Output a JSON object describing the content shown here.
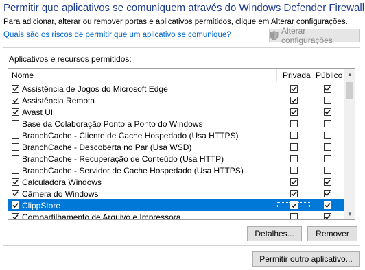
{
  "header": {
    "title": "Permitir que aplicativos se comuniquem através do Windows Defender Firewall",
    "subtitle": "Para adicionar, alterar ou remover portas e aplicativos permitidos, clique em Alterar configurações.",
    "risk_link": "Quais são os riscos de permitir que um aplicativo se comunique?",
    "change_settings_label": "Alterar configurações"
  },
  "apps_group": {
    "label": "Aplicativos e recursos permitidos:",
    "columns": {
      "name": "Nome",
      "private": "Privada",
      "public": "Público"
    },
    "rows": [
      {
        "name": "Assistência de Jogos do Microsoft Edge",
        "enabled": true,
        "private": true,
        "public": true,
        "selected": false
      },
      {
        "name": "Assistência Remota",
        "enabled": true,
        "private": true,
        "public": false,
        "selected": false
      },
      {
        "name": "Avast UI",
        "enabled": true,
        "private": true,
        "public": true,
        "selected": false
      },
      {
        "name": "Base da Colaboração Ponto a Ponto do Windows",
        "enabled": false,
        "private": false,
        "public": false,
        "selected": false
      },
      {
        "name": "BranchCache - Cliente de Cache Hospedado (Usa HTTPS)",
        "enabled": false,
        "private": false,
        "public": false,
        "selected": false
      },
      {
        "name": "BranchCache - Descoberta no Par (Usa WSD)",
        "enabled": false,
        "private": false,
        "public": false,
        "selected": false
      },
      {
        "name": "BranchCache - Recuperação de Conteúdo (Usa HTTP)",
        "enabled": false,
        "private": false,
        "public": false,
        "selected": false
      },
      {
        "name": "BranchCache - Servidor de Cache Hospedado (Usa HTTPS)",
        "enabled": false,
        "private": false,
        "public": false,
        "selected": false
      },
      {
        "name": "Calculadora Windows",
        "enabled": true,
        "private": true,
        "public": true,
        "selected": false
      },
      {
        "name": "Câmera do Windows",
        "enabled": true,
        "private": true,
        "public": true,
        "selected": false
      },
      {
        "name": "ClippStore",
        "enabled": true,
        "private": true,
        "public": true,
        "selected": true
      },
      {
        "name": "Compartilhamento de Arquivo e Impressora",
        "enabled": true,
        "private": false,
        "public": true,
        "selected": false
      }
    ],
    "details_button": "Detalhes...",
    "remove_button": "Remover"
  },
  "footer": {
    "allow_other_button": "Permitir outro aplicativo..."
  },
  "colors": {
    "title": "#1e3c8c",
    "link": "#0066cc",
    "selection": "#0078d7"
  }
}
